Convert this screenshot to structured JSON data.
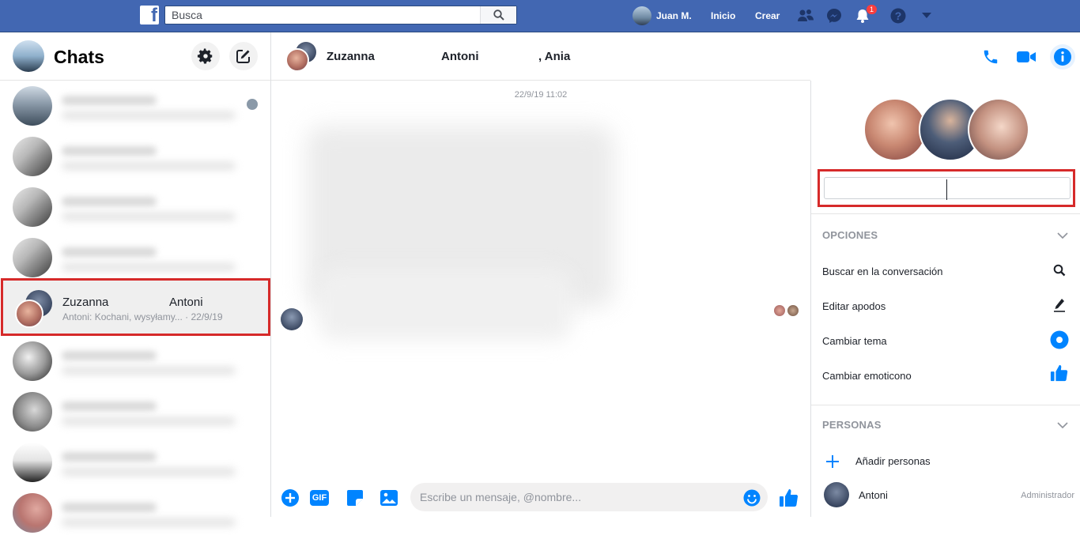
{
  "topbar": {
    "logo_letter": "f",
    "search_placeholder": "Busca",
    "user_name": "Juan M.",
    "home_label": "Inicio",
    "create_label": "Crear",
    "notification_count": "1",
    "icons": [
      "search-icon",
      "friends-icon",
      "messenger-icon",
      "bell-icon",
      "help-icon",
      "caret-down-icon"
    ]
  },
  "sidebar": {
    "title": "Chats",
    "selected_conversation": {
      "name_1": "Zuzanna",
      "name_2": "Antoni",
      "snippet": "Antoni: Kochani, wysyłamy... · 22/9/19"
    }
  },
  "chat": {
    "header_names": [
      "Zuzanna",
      "Antoni",
      ", Ania"
    ],
    "timestamp": "22/9/19 11:02",
    "composer_placeholder": "Escribe un mensaje, @nombre...",
    "gif_label": "GIF",
    "accent_color": "#0084ff"
  },
  "info": {
    "options_title": "OPCIONES",
    "options": [
      {
        "label": "Buscar en la conversación",
        "icon": "search-icon"
      },
      {
        "label": "Editar apodos",
        "icon": "pencil-icon"
      },
      {
        "label": "Cambiar tema",
        "icon": "theme-circle-icon"
      },
      {
        "label": "Cambiar emoticono",
        "icon": "thumbs-up-icon"
      }
    ],
    "people_title": "PERSONAS",
    "add_people_label": "Añadir personas",
    "people": [
      {
        "name": "Antoni",
        "role": "Administrador"
      }
    ]
  }
}
